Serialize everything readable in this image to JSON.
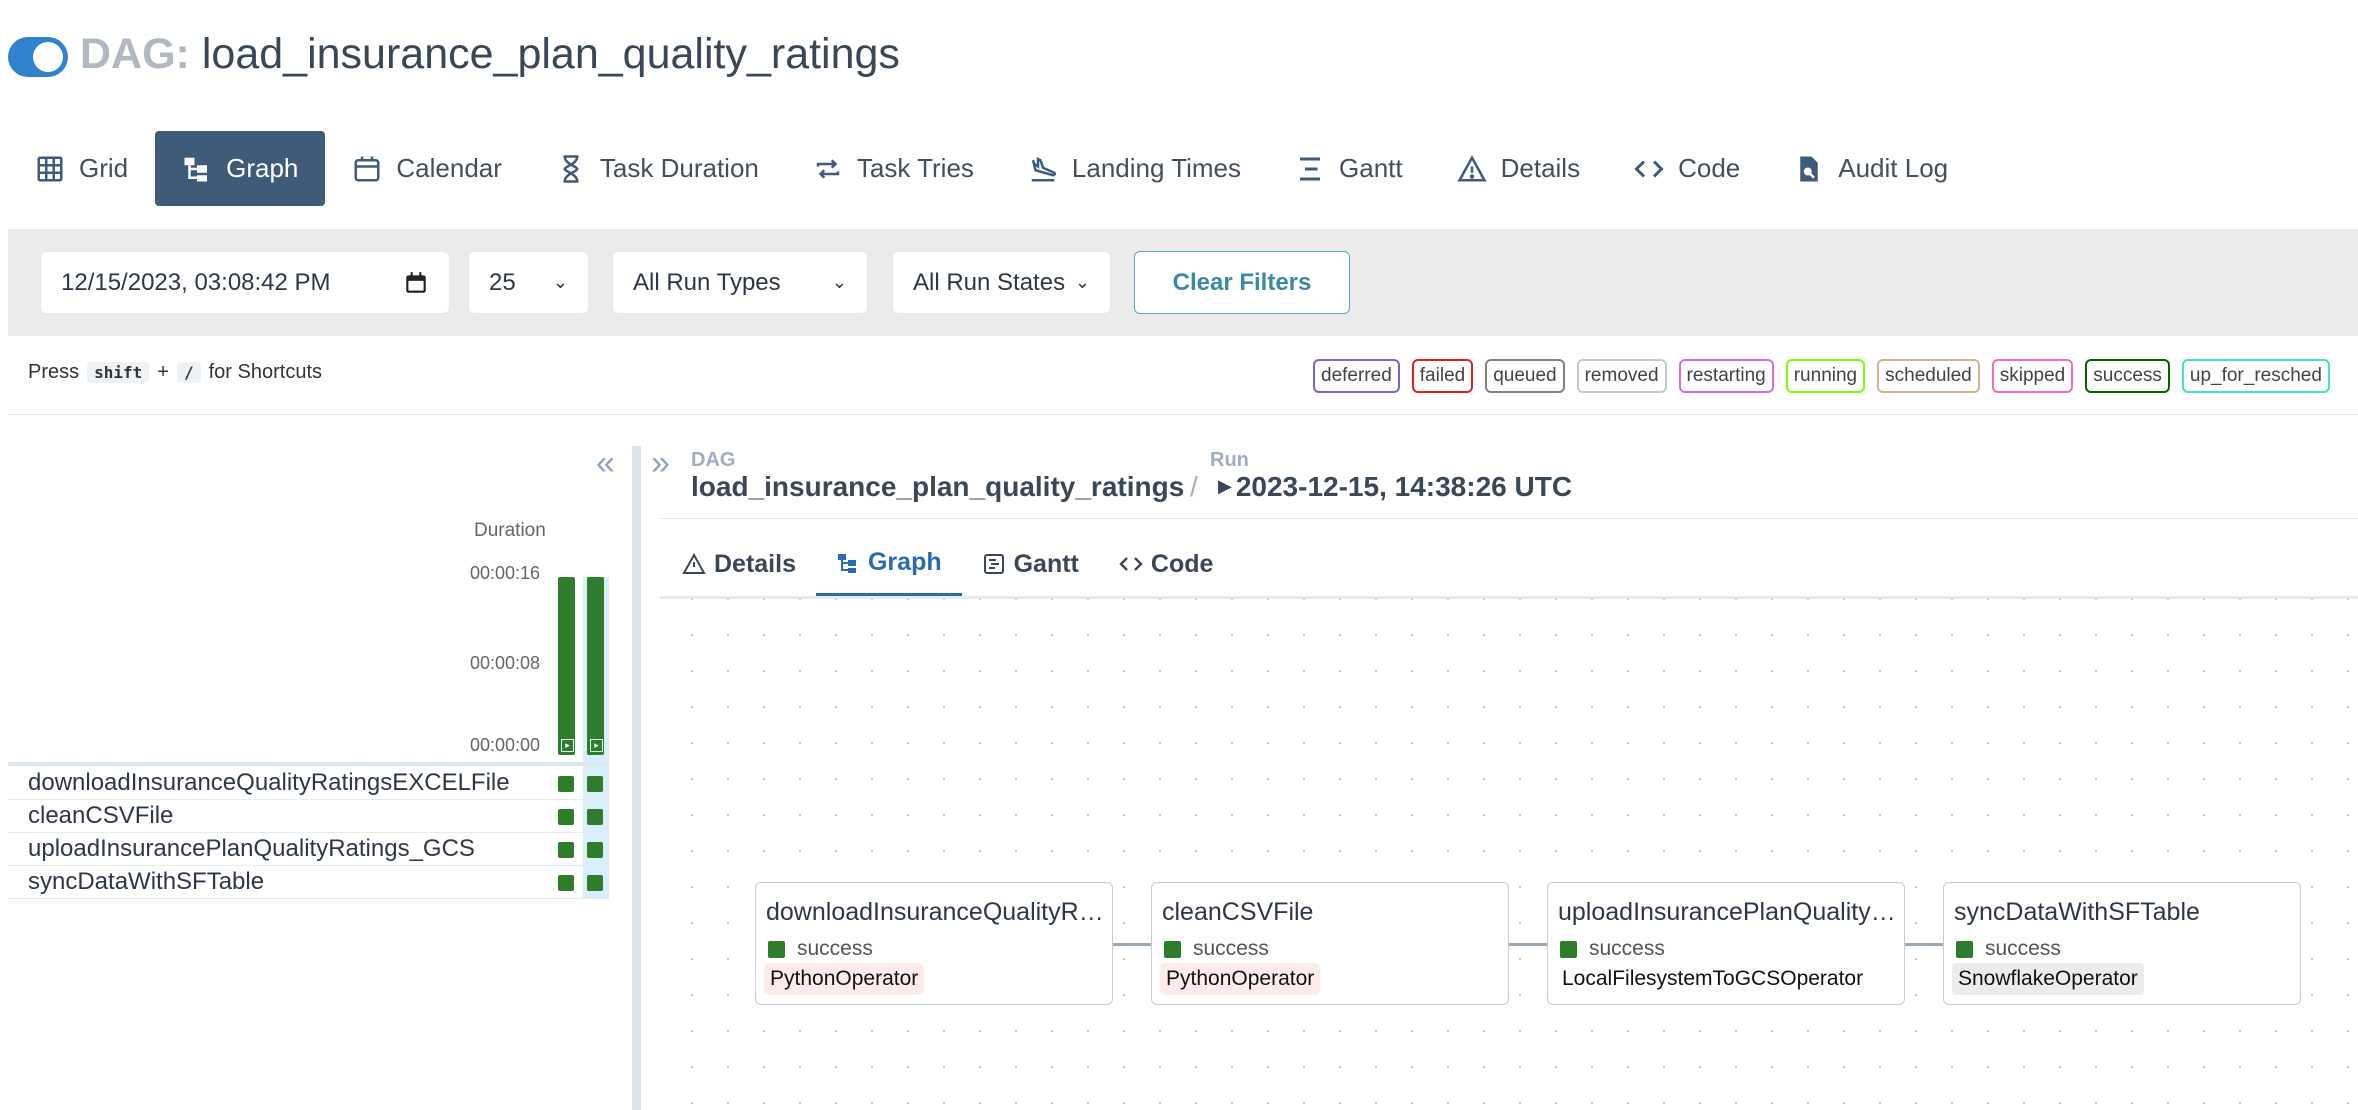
{
  "header": {
    "prefix": "DAG:",
    "dag_name": "load_insurance_plan_quality_ratings"
  },
  "nav": [
    {
      "label": "Grid",
      "icon": "grid-icon"
    },
    {
      "label": "Graph",
      "icon": "graph-icon"
    },
    {
      "label": "Calendar",
      "icon": "calendar-icon"
    },
    {
      "label": "Task Duration",
      "icon": "hourglass-icon"
    },
    {
      "label": "Task Tries",
      "icon": "retry-icon"
    },
    {
      "label": "Landing Times",
      "icon": "plane-landing-icon"
    },
    {
      "label": "Gantt",
      "icon": "gantt-icon"
    },
    {
      "label": "Details",
      "icon": "warning-triangle-icon"
    },
    {
      "label": "Code",
      "icon": "code-icon"
    },
    {
      "label": "Audit Log",
      "icon": "file-search-icon"
    }
  ],
  "filters": {
    "datetime": "12/15/2023, 03:08:42 PM",
    "num_runs": "25",
    "run_types": "All Run Types",
    "run_states": "All Run States",
    "clear_label": "Clear Filters"
  },
  "shortcut": {
    "press": "Press",
    "key1": "shift",
    "plus": "+",
    "key2": "/",
    "suffix": "for Shortcuts"
  },
  "legend": [
    {
      "label": "deferred",
      "color": "#7b61d6"
    },
    {
      "label": "failed",
      "color": "#e02020"
    },
    {
      "label": "queued",
      "color": "#808080"
    },
    {
      "label": "removed",
      "color": "#c8c8c8"
    },
    {
      "label": "restarting",
      "color": "#e066e0"
    },
    {
      "label": "running",
      "color": "#7cfc00"
    },
    {
      "label": "scheduled",
      "color": "#d2b48c"
    },
    {
      "label": "skipped",
      "color": "#ff69b4"
    },
    {
      "label": "success",
      "color": "#006400"
    },
    {
      "label": "up_for_resched",
      "color": "#40e0d0"
    }
  ],
  "grid": {
    "duration_title": "Duration",
    "ticks": [
      "00:00:16",
      "00:00:08",
      "00:00:00"
    ],
    "tasks": [
      "downloadInsuranceQualityRatingsEXCELFile",
      "cleanCSVFile",
      "uploadInsurancePlanQualityRatings_GCS",
      "syncDataWithSFTable"
    ]
  },
  "run": {
    "dag_label": "DAG",
    "dag_name": "load_insurance_plan_quality_ratings",
    "separator": "/",
    "run_label": "Run",
    "run_id": "2023-12-15, 14:38:26 UTC"
  },
  "tabs": [
    {
      "label": "Details",
      "icon": "warning-triangle-icon"
    },
    {
      "label": "Graph",
      "icon": "graph-icon"
    },
    {
      "label": "Gantt",
      "icon": "gantt-icon"
    },
    {
      "label": "Code",
      "icon": "code-icon"
    }
  ],
  "nodes": [
    {
      "title": "downloadInsuranceQualityRatingsEXCELFile",
      "state": "success",
      "operator": "PythonOperator",
      "op_bg": "#fdecea"
    },
    {
      "title": "cleanCSVFile",
      "state": "success",
      "operator": "PythonOperator",
      "op_bg": "#fdecea"
    },
    {
      "title": "uploadInsurancePlanQualityRatings_GCS",
      "state": "success",
      "operator": "LocalFilesystemToGCSOperator",
      "op_bg": "#ffffff"
    },
    {
      "title": "syncDataWithSFTable",
      "state": "success",
      "operator": "SnowflakeOperator",
      "op_bg": "#ececec"
    }
  ],
  "colors": {
    "accent": "#3182ce",
    "active_nav": "#3f5b7a",
    "success": "#2f7d2c"
  }
}
